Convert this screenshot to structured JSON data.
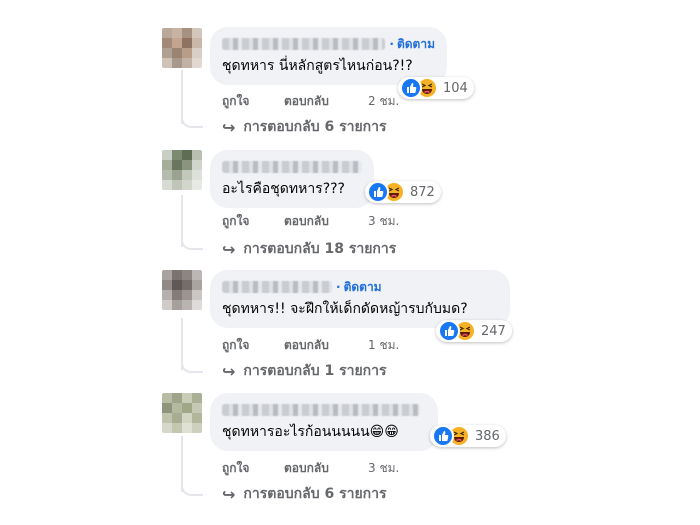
{
  "comments": [
    {
      "follow": "ติดตาม",
      "text": "ชุดทหาร นี่หลักสูตรไหนก่อน?!?",
      "reaction_count": "104",
      "like_label": "ถูกใจ",
      "reply_label": "ตอบกลับ",
      "time": "2 ชม.",
      "view_replies": "การตอบกลับ 6 รายการ"
    },
    {
      "follow": "",
      "text": "อะไรคือชุดทหาร???",
      "reaction_count": "872",
      "like_label": "ถูกใจ",
      "reply_label": "ตอบกลับ",
      "time": "3 ชม.",
      "view_replies": "การตอบกลับ 18 รายการ"
    },
    {
      "follow": "ติดตาม",
      "text": "ชุดทหาร!! จะฝึกให้เด็กดัดหญ้ารบกับมด?",
      "reaction_count": "247",
      "like_label": "ถูกใจ",
      "reply_label": "ตอบกลับ",
      "time": "1 ชม.",
      "view_replies": "การตอบกลับ 1 รายการ"
    },
    {
      "follow": "",
      "text": "ชุดทหารอะไรก้อนนนนน😁😁",
      "reaction_count": "386",
      "like_label": "ถูกใจ",
      "reply_label": "ตอบกลับ",
      "time": "3 ชม.",
      "view_replies": "การตอบกลับ 6 รายการ"
    }
  ],
  "reaction_icons": [
    "like-icon",
    "haha-icon"
  ],
  "colors": {
    "bubble": "#f0f2f5",
    "link": "#216fdb",
    "meta": "#65676b",
    "like": "#1877f2",
    "haha": "#f7b125"
  }
}
